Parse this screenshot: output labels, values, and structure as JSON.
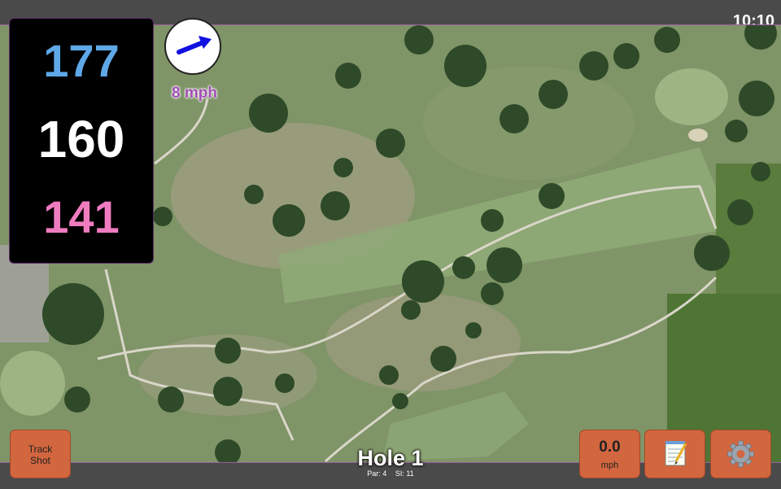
{
  "status_bar": {
    "time": "10:10"
  },
  "distances": {
    "back": "177",
    "middle": "160",
    "front": "141",
    "colors": {
      "back": "#5fa8e8",
      "middle": "#ffffff",
      "front": "#f07cc0"
    }
  },
  "wind": {
    "speed": "8 mph",
    "direction_icon": "arrow-icon"
  },
  "buttons": {
    "track_shot": {
      "line1": "Track",
      "line2": "Shot"
    },
    "speed": {
      "value": "0.0",
      "unit": "mph"
    },
    "notes_icon": "notepad-icon",
    "settings_icon": "gear-icon"
  },
  "hole": {
    "title": "Hole 1",
    "par": "Par: 4",
    "si": "SI: 11"
  },
  "colors": {
    "accent": "#d2663f",
    "frame": "#9a5fa0",
    "wind_text": "#a24fb5"
  }
}
